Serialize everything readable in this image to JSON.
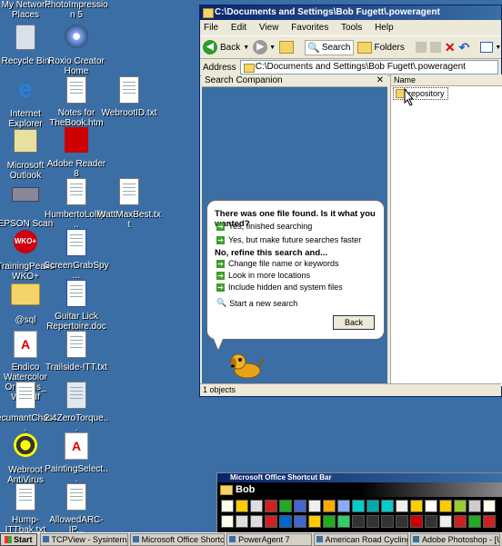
{
  "desktop_icons": [
    {
      "label": "My Network Places",
      "icon": "network-places-icon"
    },
    {
      "label": "PhotoImpression 5",
      "icon": "photoimpression-icon"
    },
    {
      "label": "Recycle Bin",
      "icon": "recycle-bin-icon"
    },
    {
      "label": "Roxio Creator Home",
      "icon": "roxio-icon"
    },
    {
      "label": "Internet Explorer",
      "icon": "internet-explorer-icon"
    },
    {
      "label": "Notes for TheBook.htm",
      "icon": "document-icon"
    },
    {
      "label": "WebrootID.txt",
      "icon": "text-file-icon"
    },
    {
      "label": "Microsoft Outlook",
      "icon": "outlook-icon"
    },
    {
      "label": "Adobe Reader 8",
      "icon": "adobe-reader-icon"
    },
    {
      "label": "EPSON Scan",
      "icon": "epson-scan-icon"
    },
    {
      "label": "HumbertoLollip...",
      "icon": "text-file-icon"
    },
    {
      "label": "WattMaxBest.txt",
      "icon": "text-file-icon"
    },
    {
      "label": "TrainingPeaks WKO+",
      "icon": "wko-icon"
    },
    {
      "label": "ScreenGrabSpy...",
      "icon": "word-doc-icon"
    },
    {
      "label": "@sql",
      "icon": "folder-icon"
    },
    {
      "label": "Guitar Lick Repertoire.doc",
      "icon": "word-doc-icon"
    },
    {
      "label": "Endico Watercolor Originals_ We.pdf",
      "icon": "pdf-icon"
    },
    {
      "label": "Trailside-ITT.txt",
      "icon": "text-file-icon"
    },
    {
      "label": "recumantChas...",
      "icon": "text-file-icon"
    },
    {
      "label": "2.4ZeroTorque...",
      "icon": "movie-icon"
    },
    {
      "label": "Webroot AntiVirus",
      "icon": "webroot-icon"
    },
    {
      "label": "PaintingSelect...",
      "icon": "pdf-icon"
    },
    {
      "label": "Hump-ITTbak.txt",
      "icon": "text-file-icon"
    },
    {
      "label": "AllowedARC-IP...",
      "icon": "text-file-icon"
    }
  ],
  "explorer": {
    "title": "C:\\Documents and Settings\\Bob Fugett\\.poweragent",
    "menu": [
      "File",
      "Edit",
      "View",
      "Favorites",
      "Tools",
      "Help"
    ],
    "toolbar": {
      "back": "Back",
      "search": "Search",
      "folders": "Folders"
    },
    "address_label": "Address",
    "address_value": "C:\\Documents and Settings\\Bob Fugett\\.poweragent",
    "search_pane": {
      "header": "Search Companion",
      "question": "There was one file found.  Is it what you wanted?",
      "yes_options": [
        "Yes, finished searching",
        "Yes, but make future searches faster"
      ],
      "refine_heading": "No, refine this search and...",
      "refine_options": [
        "Change file name or keywords",
        "Look in more locations",
        "Include hidden and system files"
      ],
      "new_search": "Start a new search",
      "back_button": "Back"
    },
    "file_pane": {
      "column_name": "Name",
      "items": [
        "repository"
      ]
    },
    "status": "1 objects"
  },
  "office_bar": {
    "title": "Microsoft Office Shortcut Bar",
    "group": "Bob"
  },
  "taskbar": {
    "start": "Start",
    "tasks": [
      "TCPView - Sysinternals: ...",
      "Microsoft Office Shortcut...",
      "PowerAgent 7",
      "American Road Cycling : ...",
      "Adobe Photoshop - [Unti..."
    ]
  }
}
